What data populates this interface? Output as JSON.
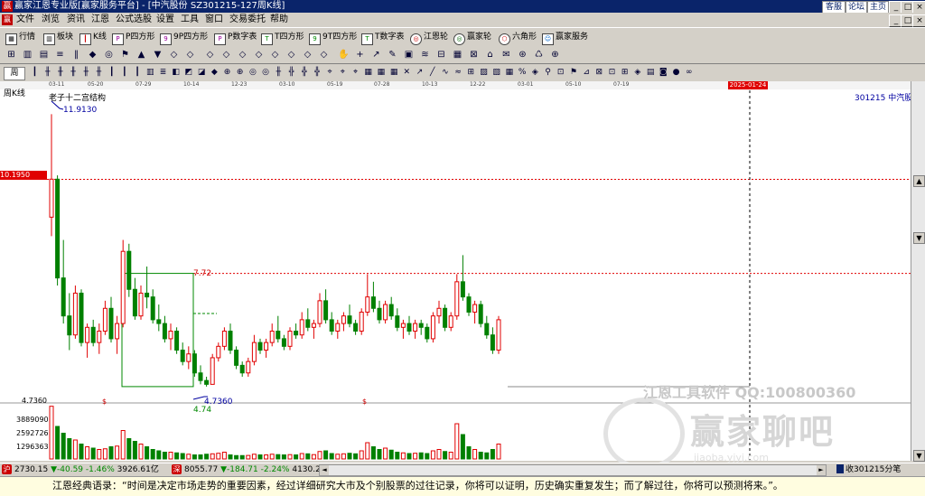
{
  "titlebar": {
    "logo": "赢",
    "title": "赢家江恩专业版[赢家服务平台] - [中汽股份  SZ301215-127周K线]",
    "links": [
      "客服",
      "论坛",
      "主页"
    ],
    "buttons": [
      "_",
      "□",
      "×"
    ]
  },
  "menubar": {
    "items": [
      "文件",
      "浏览",
      "资讯",
      "江恩",
      "公式选股",
      "设置",
      "工具",
      "窗口",
      "交易委托",
      "帮助"
    ],
    "buttons": [
      "_",
      "□",
      "×"
    ]
  },
  "toolbar1": {
    "items": [
      "行情",
      "板块",
      "K线",
      "P四方形",
      "9P四方形",
      "P数字表",
      "T四方形",
      "9T四方形",
      "T数字表",
      "江恩轮",
      "赢家轮",
      "六角形",
      "赢家服务"
    ]
  },
  "toolbar3": {
    "items": [
      "周"
    ]
  },
  "chart": {
    "period_label": "周K线",
    "structure_label": "老子十二宫结构",
    "stock_label": "301215  中汽股份",
    "high_label": "11.9130",
    "price_tag": "10.1950",
    "box_top_label": "7.72",
    "box_bottom_label": "4.74",
    "low_label": "4.7360",
    "low_label_left": "4.7360",
    "dollar_marks": [
      "$",
      "$"
    ],
    "cursor_date": "2025-01-24",
    "vol_labels": [
      "3889090",
      "2592726",
      "1296363"
    ],
    "dates": [
      "03-11",
      "05-20",
      "07-29",
      "10-14",
      "12-23",
      "03-10",
      "05-19",
      "07-28",
      "10-13",
      "12-22",
      "03-01",
      "05-10",
      "07-19"
    ],
    "watermark_text": "江恩工具软件  QQ:100800360",
    "watermark_brand": "赢家聊吧",
    "watermark_url": "jiaoba.yjyj.com"
  },
  "chart_data": {
    "type": "candlestick",
    "high": 11.913,
    "low": 4.736,
    "ylim": [
      4.5,
      12.3
    ],
    "weekly": [
      [
        9.2,
        11.91,
        8.7,
        10.2
      ],
      [
        10.2,
        10.3,
        7.4,
        7.6
      ],
      [
        7.6,
        8.6,
        6.4,
        6.6
      ],
      [
        6.6,
        7.2,
        5.7,
        6.1
      ],
      [
        6.1,
        7.4,
        6.0,
        7.2
      ],
      [
        7.2,
        7.3,
        5.8,
        5.9
      ],
      [
        5.9,
        6.4,
        5.5,
        6.3
      ],
      [
        6.3,
        6.5,
        5.8,
        5.9
      ],
      [
        5.9,
        6.4,
        5.6,
        6.2
      ],
      [
        6.2,
        7.0,
        6.1,
        6.8
      ],
      [
        6.8,
        7.1,
        5.9,
        6.0
      ],
      [
        6.0,
        6.6,
        5.6,
        6.4
      ],
      [
        6.4,
        8.6,
        6.3,
        8.3
      ],
      [
        8.3,
        8.5,
        7.1,
        7.3
      ],
      [
        7.3,
        7.6,
        6.5,
        6.6
      ],
      [
        6.6,
        7.4,
        6.5,
        7.2
      ],
      [
        7.2,
        7.9,
        6.8,
        7.1
      ],
      [
        7.1,
        7.3,
        6.4,
        6.5
      ],
      [
        6.5,
        6.9,
        6.2,
        6.4
      ],
      [
        6.4,
        6.6,
        5.9,
        6.0
      ],
      [
        6.0,
        6.4,
        5.7,
        6.2
      ],
      [
        6.2,
        6.3,
        5.6,
        5.7
      ],
      [
        5.7,
        5.9,
        5.3,
        5.4
      ],
      [
        5.4,
        5.8,
        5.2,
        5.6
      ],
      [
        5.6,
        5.7,
        5.0,
        5.1
      ],
      [
        5.1,
        5.3,
        4.8,
        4.9
      ],
      [
        4.9,
        5.0,
        4.74,
        4.8
      ],
      [
        4.8,
        5.6,
        4.8,
        5.5
      ],
      [
        5.5,
        5.9,
        5.4,
        5.8
      ],
      [
        5.8,
        6.3,
        5.7,
        6.2
      ],
      [
        6.2,
        6.4,
        5.6,
        5.7
      ],
      [
        5.7,
        5.8,
        5.2,
        5.3
      ],
      [
        5.3,
        5.4,
        5.0,
        5.1
      ],
      [
        5.1,
        5.5,
        5.0,
        5.4
      ],
      [
        5.4,
        6.1,
        5.3,
        5.9
      ],
      [
        5.9,
        6.0,
        5.6,
        5.7
      ],
      [
        5.7,
        6.0,
        5.5,
        5.9
      ],
      [
        5.9,
        6.4,
        5.8,
        6.2
      ],
      [
        6.2,
        6.6,
        5.9,
        6.0
      ],
      [
        6.0,
        6.1,
        5.7,
        5.8
      ],
      [
        5.8,
        6.3,
        5.7,
        6.2
      ],
      [
        6.2,
        6.4,
        6.0,
        6.1
      ],
      [
        6.1,
        6.7,
        6.0,
        6.5
      ],
      [
        6.5,
        6.8,
        6.2,
        6.3
      ],
      [
        6.3,
        6.5,
        6.0,
        6.4
      ],
      [
        6.4,
        7.2,
        6.3,
        7.0
      ],
      [
        7.0,
        7.3,
        6.4,
        6.5
      ],
      [
        6.5,
        6.7,
        6.1,
        6.2
      ],
      [
        6.2,
        6.5,
        6.0,
        6.4
      ],
      [
        6.4,
        6.7,
        6.2,
        6.6
      ],
      [
        6.6,
        6.9,
        6.3,
        6.4
      ],
      [
        6.4,
        6.5,
        6.1,
        6.2
      ],
      [
        6.2,
        6.8,
        6.1,
        6.7
      ],
      [
        6.7,
        7.7,
        6.6,
        7.1
      ],
      [
        7.1,
        7.5,
        6.7,
        6.8
      ],
      [
        6.8,
        7.0,
        6.4,
        6.5
      ],
      [
        6.5,
        7.0,
        6.4,
        6.9
      ],
      [
        6.9,
        7.1,
        6.5,
        6.6
      ],
      [
        6.6,
        6.8,
        6.2,
        6.3
      ],
      [
        6.3,
        6.5,
        6.0,
        6.4
      ],
      [
        6.4,
        6.6,
        6.1,
        6.2
      ],
      [
        6.2,
        6.5,
        6.0,
        6.4
      ],
      [
        6.4,
        6.5,
        6.1,
        6.3
      ],
      [
        6.3,
        6.4,
        5.9,
        6.0
      ],
      [
        6.0,
        6.7,
        5.9,
        6.6
      ],
      [
        6.6,
        7.0,
        6.4,
        6.8
      ],
      [
        6.8,
        6.9,
        6.2,
        6.3
      ],
      [
        6.3,
        6.7,
        6.2,
        6.6
      ],
      [
        6.6,
        7.7,
        6.5,
        7.5
      ],
      [
        7.5,
        8.2,
        7.0,
        7.1
      ],
      [
        7.1,
        7.2,
        6.6,
        6.7
      ],
      [
        6.7,
        7.0,
        6.4,
        6.9
      ],
      [
        6.9,
        7.0,
        6.3,
        6.4
      ],
      [
        6.4,
        6.6,
        6.0,
        6.1
      ],
      [
        6.1,
        6.3,
        5.6,
        5.7
      ],
      [
        5.7,
        6.6,
        5.6,
        6.5
      ]
    ],
    "volume": [
      3889090,
      2400000,
      1900000,
      1500000,
      1400000,
      1100000,
      900000,
      800000,
      700000,
      750000,
      900000,
      950000,
      2100000,
      1500000,
      1300000,
      1100000,
      900000,
      700000,
      600000,
      500000,
      500000,
      450000,
      400000,
      350000,
      300000,
      300000,
      350000,
      380000,
      420000,
      500000,
      300000,
      250000,
      250000,
      260000,
      350000,
      300000,
      300000,
      350000,
      320000,
      300000,
      320000,
      300000,
      400000,
      380000,
      320000,
      550000,
      600000,
      400000,
      350000,
      380000,
      420000,
      380000,
      600000,
      1200000,
      900000,
      700000,
      800000,
      650000,
      500000,
      450000,
      400000,
      420000,
      450000,
      400000,
      600000,
      700000,
      550000,
      500000,
      2600000,
      1800000,
      900000,
      700000,
      500000,
      450000,
      700000,
      1100000
    ]
  },
  "statusbar": {
    "idx1": "2730.15",
    "idx1_chg": "-40.59",
    "idx1_pct": "-1.46%",
    "idx1_amt": "3926.61亿",
    "idx2": "8055.77",
    "idx2_chg": "-184.71",
    "idx2_pct": "-2.24%",
    "idx2_amt": "4130.2",
    "right_text": "收301215分笔"
  },
  "quotebar": {
    "text": "江恩经典语录：“时间是决定市场走势的重要因素，经过详细研究大市及个别股票的过往记录，你将可以证明，历史确实重复发生；而了解过往，你将可以预测将来。”。"
  }
}
